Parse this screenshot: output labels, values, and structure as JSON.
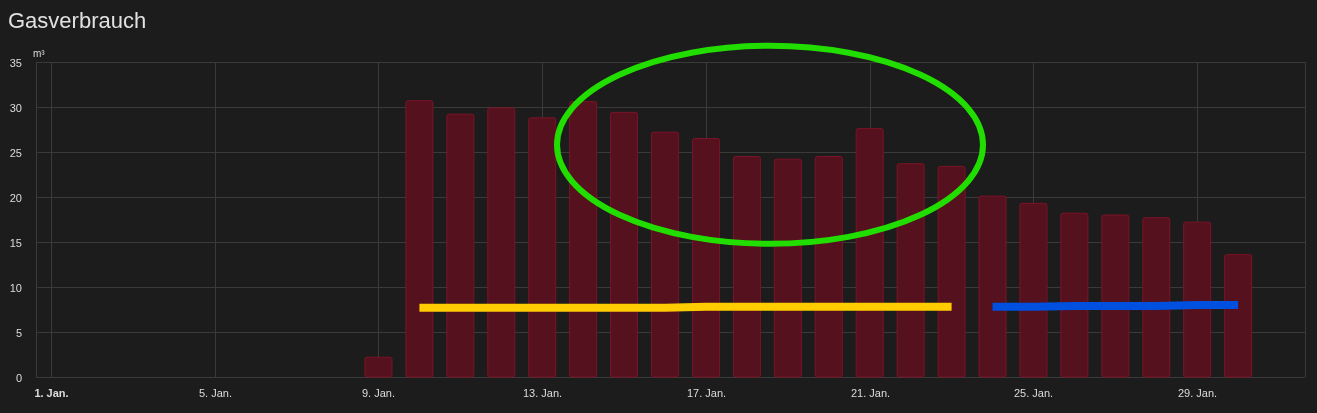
{
  "card": {
    "title": "Gasverbrauch"
  },
  "chart": {
    "chart_data": {
      "type": "bar",
      "ylabel": "m³",
      "categories": [
        "1. Jan.",
        null,
        null,
        null,
        "5. Jan.",
        null,
        null,
        null,
        "9. Jan.",
        null,
        null,
        null,
        "13. Jan.",
        null,
        null,
        null,
        "17. Jan.",
        null,
        null,
        null,
        "21. Jan.",
        null,
        null,
        null,
        "25. Jan.",
        null,
        null,
        null,
        "29. Jan.",
        null
      ],
      "series": [
        {
          "type": "bar",
          "color": "#55111d",
          "values": [
            null,
            null,
            null,
            null,
            null,
            null,
            null,
            null,
            2.2,
            30.7,
            29.2,
            29.9,
            28.8,
            30.6,
            29.4,
            27.2,
            26.5,
            24.5,
            24.2,
            24.5,
            27.6,
            23.7,
            23.4,
            20.1,
            19.3,
            18.2,
            18.0,
            17.7,
            17.2,
            13.6
          ]
        },
        {
          "type": "line",
          "color": "#ffcc00",
          "values": [
            null,
            null,
            null,
            null,
            null,
            null,
            null,
            null,
            null,
            7.7,
            7.7,
            7.7,
            7.7,
            7.7,
            7.7,
            7.7,
            7.8,
            7.8,
            7.8,
            7.8,
            7.8,
            7.8,
            7.8,
            null,
            null,
            null,
            null,
            null,
            null,
            null
          ]
        },
        {
          "type": "line",
          "color": "#0050e0",
          "values": [
            null,
            null,
            null,
            null,
            null,
            null,
            null,
            null,
            null,
            null,
            null,
            null,
            null,
            null,
            null,
            null,
            null,
            null,
            null,
            null,
            null,
            null,
            null,
            7.8,
            7.8,
            7.9,
            7.9,
            7.9,
            8.0,
            8.0
          ]
        }
      ],
      "ylim": [
        0,
        35
      ],
      "grid": true,
      "yticks": [
        0,
        5,
        10,
        15,
        20,
        25,
        30,
        35
      ]
    }
  },
  "markup": {
    "kind": "ellipse",
    "color": "#22dd00"
  }
}
